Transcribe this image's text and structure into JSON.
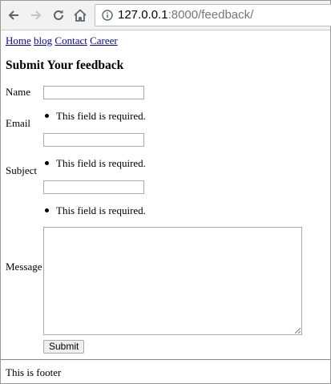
{
  "browser": {
    "url_host": "127.0.0.1",
    "url_rest": ":8000/feedback/"
  },
  "nav_links": [
    "Home",
    "blog",
    "Contact",
    "Career"
  ],
  "title": "Submit Your feedback",
  "form": {
    "name_label": "Name",
    "email_label": "Email",
    "subject_label": "Subject",
    "message_label": "Message",
    "required_error": "This field is required.",
    "name_value": "",
    "email_value": "",
    "subject_value": "",
    "message_value": "",
    "submit_label": "Submit"
  },
  "footer": "This is footer"
}
